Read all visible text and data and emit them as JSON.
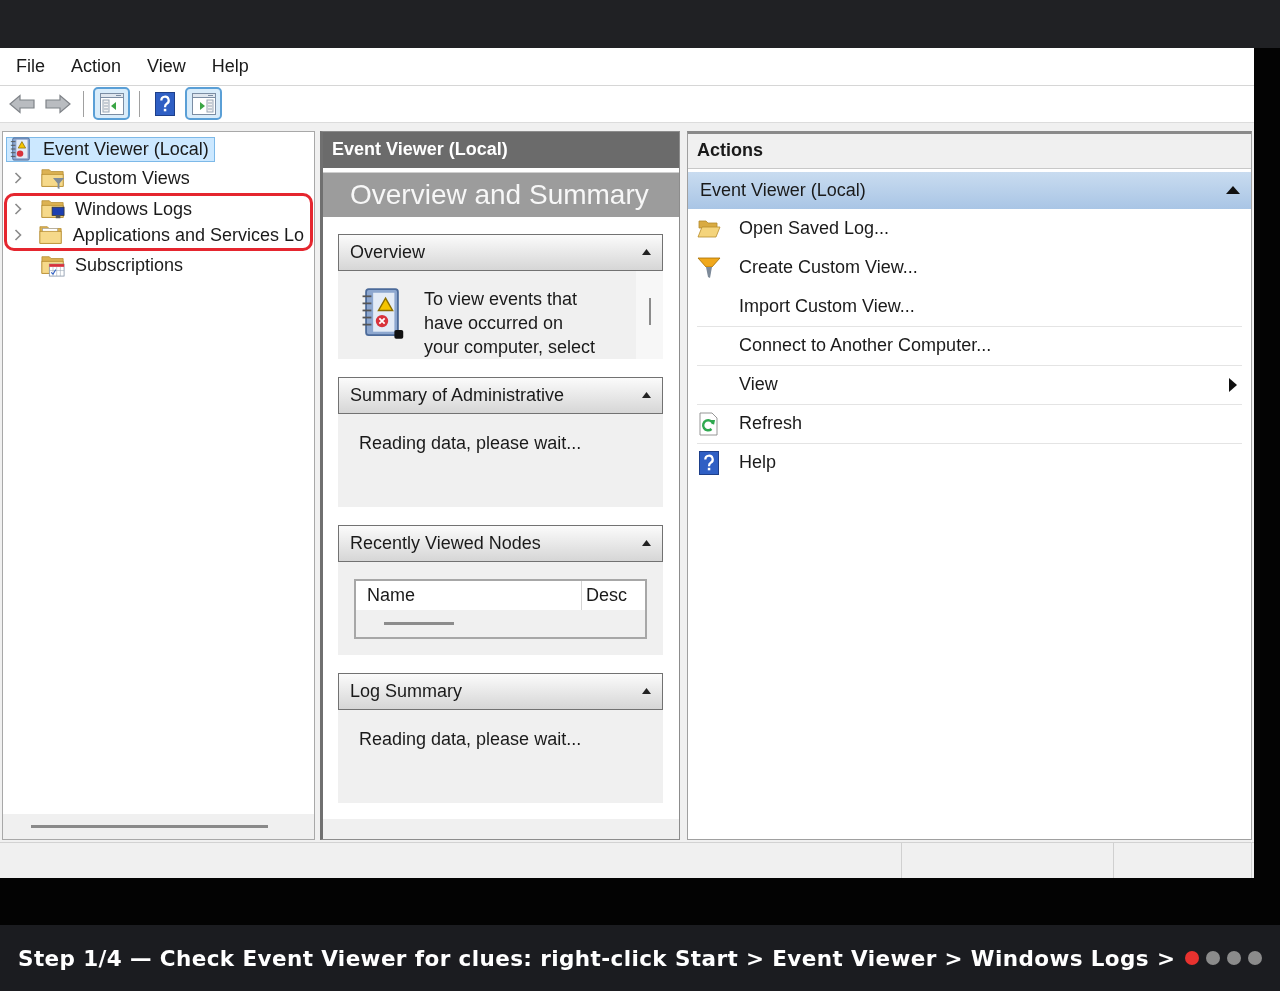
{
  "menu": [
    "File",
    "Action",
    "View",
    "Help"
  ],
  "toolbar": [
    {
      "kind": "back"
    },
    {
      "kind": "forward"
    },
    {
      "kind": "separator"
    },
    {
      "kind": "tree_toggle",
      "pressed": true
    },
    {
      "kind": "separator"
    },
    {
      "kind": "help"
    },
    {
      "kind": "actions_toggle",
      "pressed": true
    }
  ],
  "tree": [
    {
      "label": "Event Viewer (Local)",
      "kind": "root",
      "selected": true,
      "expandable": false,
      "highlighted": false,
      "children": [
        {
          "label": "Custom Views",
          "kind": "filter",
          "selected": false,
          "expandable": true,
          "highlighted": false
        },
        {
          "label": "Windows Logs",
          "kind": "logs",
          "selected": false,
          "expandable": true,
          "highlighted": true
        },
        {
          "label": "Applications and Services Lo",
          "kind": "folder",
          "selected": false,
          "expandable": true,
          "highlighted": true
        },
        {
          "label": "Subscriptions",
          "kind": "calendar",
          "selected": false,
          "expandable": false,
          "highlighted": false
        }
      ]
    }
  ],
  "center": {
    "title": "Event Viewer (Local)",
    "heading": "Overview and Summary",
    "sections": [
      {
        "kind": "intro",
        "title": "Overview",
        "expanded": true,
        "text": "To view events that have occurred on your computer, select"
      },
      {
        "kind": "message",
        "title": "Summary of Administrative",
        "expanded": true,
        "text": "Reading data, please wait..."
      },
      {
        "kind": "table",
        "title": "Recently Viewed Nodes",
        "expanded": true,
        "columns": [
          "Name",
          "Desc"
        ]
      },
      {
        "kind": "message",
        "title": "Log Summary",
        "expanded": true,
        "text": "Reading data, please wait..."
      }
    ]
  },
  "actions": {
    "title": "Actions",
    "group": {
      "title": "Event Viewer (Local)",
      "expanded": true,
      "items": [
        {
          "label": "Open Saved Log...",
          "kind": "open",
          "submenu": false
        },
        {
          "label": "Create Custom View...",
          "kind": "filter",
          "submenu": false
        },
        {
          "label": "Import Custom View...",
          "kind": "plain",
          "submenu": false
        },
        {
          "label": "Connect to Another Computer...",
          "kind": "plain",
          "submenu": false
        },
        {
          "label": "View",
          "kind": "plain",
          "submenu": true
        },
        {
          "label": "Refresh",
          "kind": "refresh",
          "submenu": false
        },
        {
          "label": "Help",
          "kind": "help",
          "submenu": false
        }
      ]
    }
  },
  "caption": {
    "text": "Step 1/4 — Check Event Viewer for clues: right-click Start > Event Viewer > Windows Logs >",
    "steps": [
      {
        "selected": true
      },
      {
        "selected": false
      },
      {
        "selected": false
      },
      {
        "selected": false
      }
    ]
  }
}
